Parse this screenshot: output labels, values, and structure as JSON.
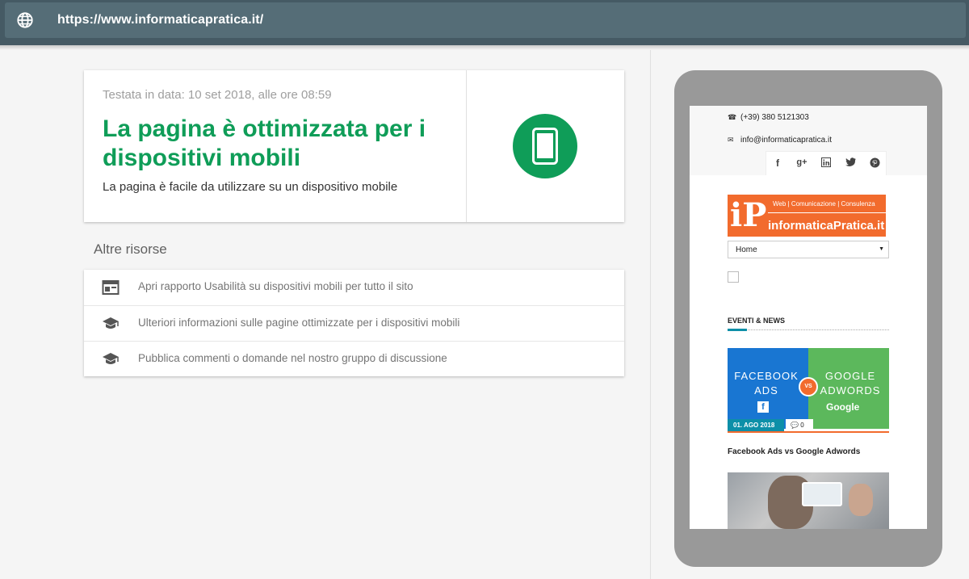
{
  "browser": {
    "url": "https://www.informaticapratica.it/",
    "globe_icon": "globe-icon"
  },
  "result": {
    "tested_date": "Testata in data: 10 set 2018, alle ore 08:59",
    "title": "La pagina è ottimizzata per i dispositivi mobili",
    "subtitle": "La pagina è facile da utilizzare su un dispositivo mobile",
    "icon": "smartphone-icon",
    "accent_color": "#0f9d58"
  },
  "resources": {
    "title": "Altre risorse",
    "items": [
      {
        "icon": "report-icon",
        "label": "Apri rapporto Usabilità su dispositivi mobili per tutto il sito"
      },
      {
        "icon": "school-icon",
        "label": "Ulteriori informazioni sulle pagine ottimizzate per i dispositivi mobili"
      },
      {
        "icon": "school-icon",
        "label": "Pubblica commenti o domande nel nostro gruppo di discussione"
      }
    ]
  },
  "preview": {
    "phone": "(+39) 380 5121303",
    "email": "info@informaticapratica.it",
    "social": [
      "f",
      "g+",
      "in",
      "twitter",
      "pinterest"
    ],
    "logo": {
      "mark": "iP",
      "tagline": "Web | Comunicazione | Consulenza",
      "name": "informaticaPratica.it",
      "color": "#f26b2d"
    },
    "nav_selected": "Home",
    "section_title": "EVENTI & NEWS",
    "promo": {
      "left_text": "FACEBOOK ADS",
      "right_text": "GOOGLE ADWORDS",
      "vs": "VS",
      "fb_mark": "f",
      "google_mark": "Google",
      "date": "01. AGO 2018",
      "comments": "0"
    },
    "article_title": "Facebook Ads vs Google Adwords"
  }
}
